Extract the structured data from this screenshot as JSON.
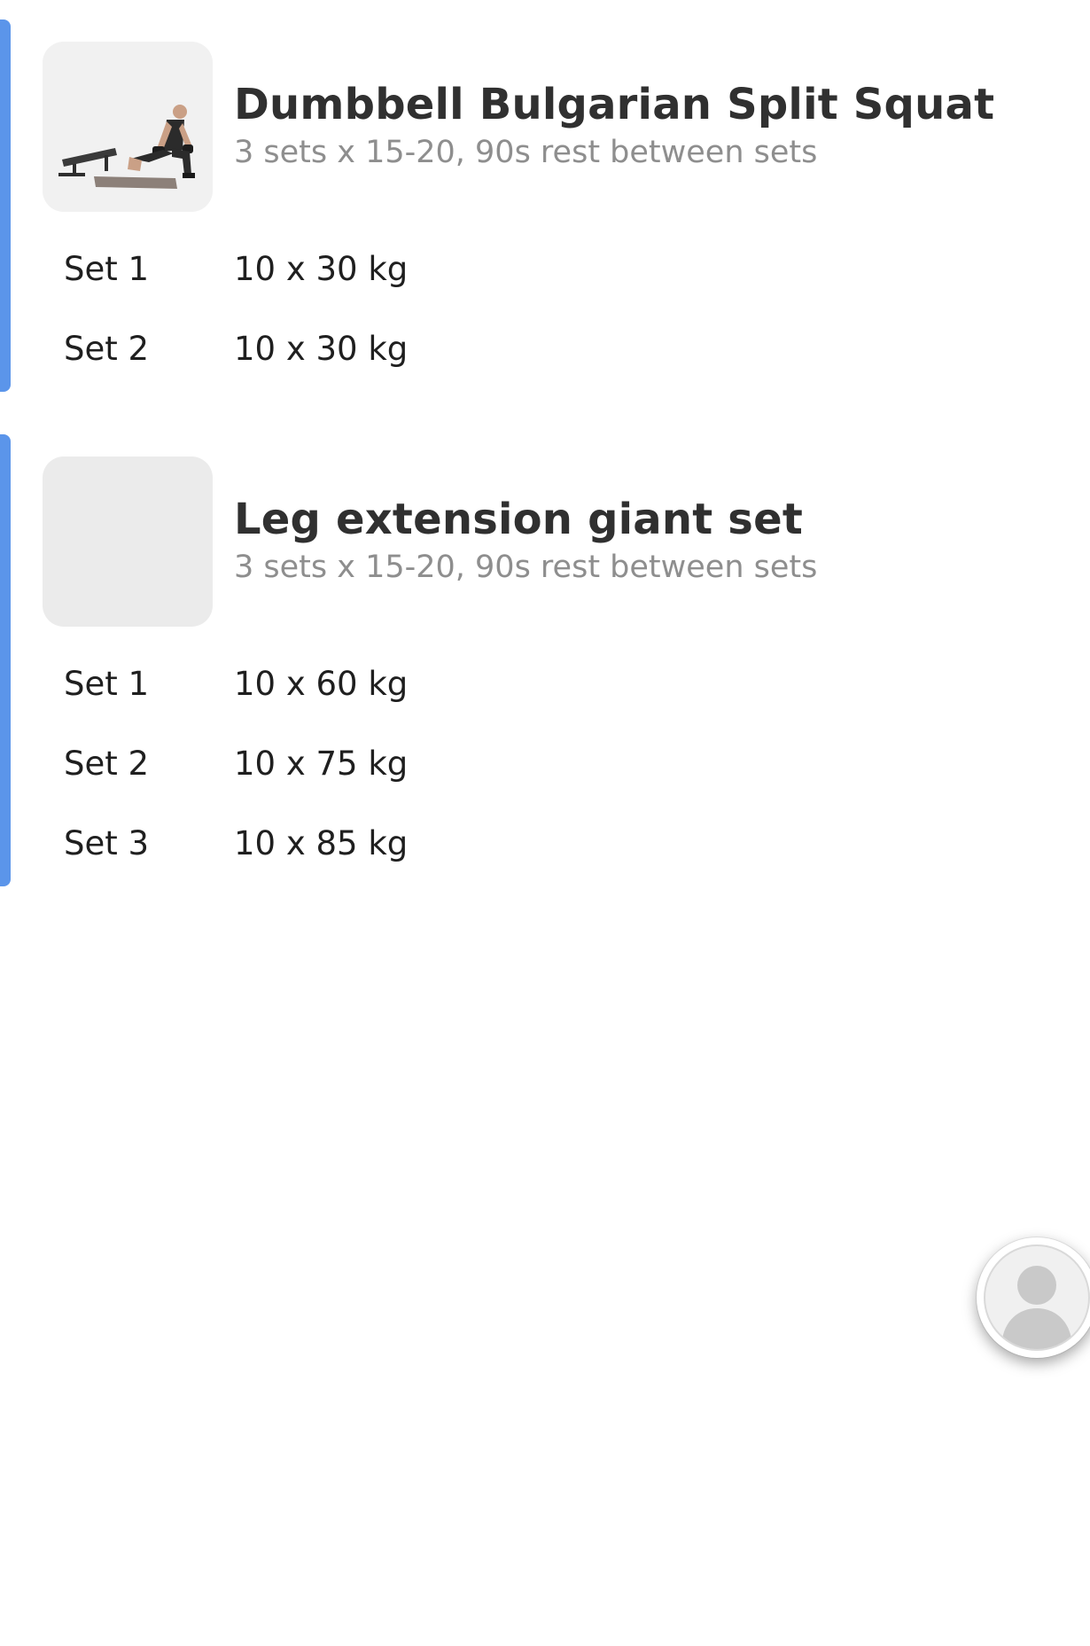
{
  "exercises": [
    {
      "title": "Dumbbell Bulgarian Split Squat",
      "subtitle": "3 sets x 15-20, 90s rest between sets",
      "has_photo": true,
      "sets": [
        {
          "label": "Set 1",
          "value": "10 x 30 kg"
        },
        {
          "label": "Set 2",
          "value": "10 x 30 kg"
        }
      ]
    },
    {
      "title": "Leg extension giant set",
      "subtitle": "3 sets x 15-20, 90s rest between sets",
      "has_photo": false,
      "sets": [
        {
          "label": "Set 1",
          "value": "10 x 60 kg"
        },
        {
          "label": "Set 2",
          "value": "10 x 75 kg"
        },
        {
          "label": "Set 3",
          "value": "10 x 85 kg"
        }
      ]
    }
  ],
  "colors": {
    "accent": "#5b95ea",
    "title": "#303030",
    "subtitle": "#8e8e8e",
    "placeholder": "#ebebeb"
  },
  "floating_avatar": {
    "icon": "user-avatar-icon"
  }
}
